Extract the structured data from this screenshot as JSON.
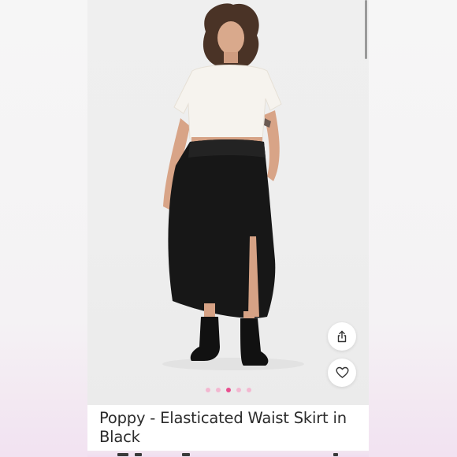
{
  "product": {
    "title": "Poppy - Elasticated Waist Skirt in Black"
  },
  "gallery": {
    "total_images": 5,
    "active_index": 2
  },
  "actions": {
    "share_icon": "share-icon",
    "favorite_icon": "heart-icon"
  },
  "colors": {
    "dot_active": "#e94d8e",
    "dot_inactive": "#f3b8d1",
    "title_text": "#2b2b2b"
  }
}
